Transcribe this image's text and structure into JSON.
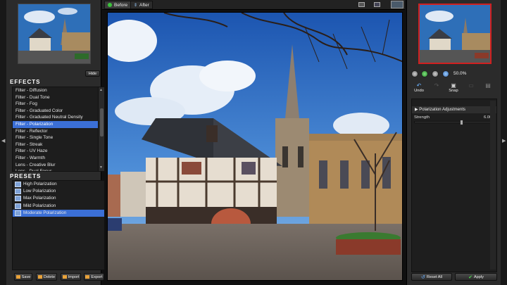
{
  "topbar": {
    "before_label": "Before",
    "after_label": "After"
  },
  "left_panel": {
    "hide_label": "Hide",
    "effects_title": "EFFECTS",
    "effects": [
      "Filter - Diffusion",
      "Filter - Dual Tone",
      "Filter - Fog",
      "Filter - Graduated Color",
      "Filter - Graduated Neutral Density",
      "Filter - Polarization",
      "Filter - Reflector",
      "Filter - Single Tone",
      "Filter - Streak",
      "Filter - UV Haze",
      "Filter - Warmth",
      "Lens - Creative Blur",
      "Lens - Dual Focus"
    ],
    "selected_effect": "Filter - Polarization",
    "presets_title": "PRESETS",
    "presets": [
      "High Polarization",
      "Low Polarization",
      "Max Polarization",
      "Mild Polarization",
      "Moderate Polarization"
    ],
    "selected_preset": "Moderate Polarization",
    "buttons": {
      "save": "Save",
      "delete": "Delete",
      "import": "Import",
      "export": "Export"
    }
  },
  "right_panel": {
    "zoom_level": "50.0%",
    "tools": {
      "undo": "Undo",
      "snap": "Snap"
    },
    "adjustments_title": "Polarization Adjustments",
    "strength_label": "Strength",
    "strength_value": "6.00",
    "strength_fraction": 0.6,
    "reset_label": "Reset All",
    "apply_label": "Apply"
  },
  "colors": {
    "selection": "#3b6fd6",
    "panel": "#2b2b2b",
    "navigator_frame": "#d02020"
  }
}
